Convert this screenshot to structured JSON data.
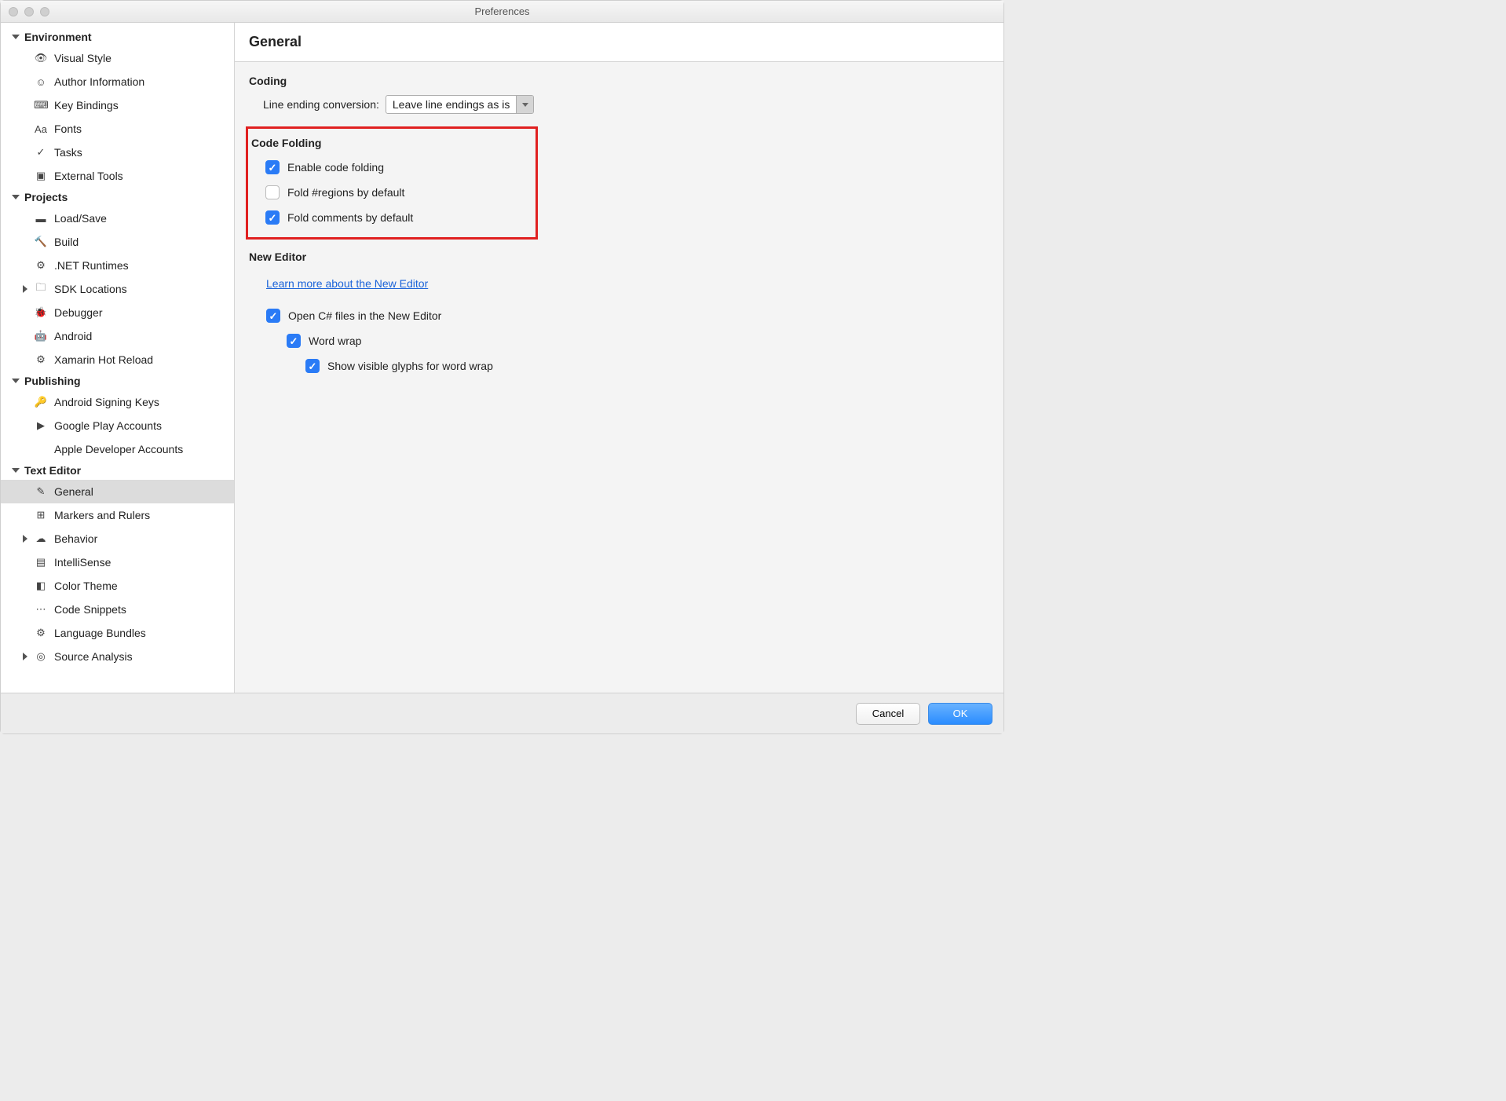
{
  "window_title": "Preferences",
  "sidebar": {
    "categories": [
      {
        "name": "Environment",
        "items": [
          {
            "label": "Visual Style",
            "icon": "👁"
          },
          {
            "label": "Author Information",
            "icon": "☺"
          },
          {
            "label": "Key Bindings",
            "icon": "⌨"
          },
          {
            "label": "Fonts",
            "icon": "Aa"
          },
          {
            "label": "Tasks",
            "icon": "✓"
          },
          {
            "label": "External Tools",
            "icon": "▣"
          }
        ]
      },
      {
        "name": "Projects",
        "items": [
          {
            "label": "Load/Save",
            "icon": "▬"
          },
          {
            "label": "Build",
            "icon": "🔨"
          },
          {
            "label": ".NET Runtimes",
            "icon": "⚙"
          },
          {
            "label": "SDK Locations",
            "icon": "🗀",
            "has_children": true
          },
          {
            "label": "Debugger",
            "icon": "🐞"
          },
          {
            "label": "Android",
            "icon": "🤖"
          },
          {
            "label": "Xamarin Hot Reload",
            "icon": "⚙"
          }
        ]
      },
      {
        "name": "Publishing",
        "items": [
          {
            "label": "Android Signing Keys",
            "icon": "🔑"
          },
          {
            "label": "Google Play Accounts",
            "icon": "▶"
          },
          {
            "label": "Apple Developer Accounts",
            "icon": ""
          }
        ]
      },
      {
        "name": "Text Editor",
        "items": [
          {
            "label": "General",
            "icon": "✎",
            "selected": true
          },
          {
            "label": "Markers and Rulers",
            "icon": "⊞"
          },
          {
            "label": "Behavior",
            "icon": "☁",
            "has_children": true
          },
          {
            "label": "IntelliSense",
            "icon": "▤"
          },
          {
            "label": "Color Theme",
            "icon": "◧"
          },
          {
            "label": "Code Snippets",
            "icon": "⋯"
          },
          {
            "label": "Language Bundles",
            "icon": "⚙"
          },
          {
            "label": "Source Analysis",
            "icon": "◎",
            "has_children": true
          }
        ]
      }
    ]
  },
  "main": {
    "header": "General",
    "coding": {
      "title": "Coding",
      "line_ending_label": "Line ending conversion:",
      "line_ending_value": "Leave line endings as is"
    },
    "code_folding": {
      "title": "Code Folding",
      "opt1": {
        "label": "Enable code folding",
        "checked": true
      },
      "opt2": {
        "label": "Fold #regions by default",
        "checked": false
      },
      "opt3": {
        "label": "Fold comments by default",
        "checked": true
      }
    },
    "new_editor": {
      "title": "New Editor",
      "link": "Learn more about the New Editor",
      "opt1": {
        "label": "Open C# files in the New Editor",
        "checked": true
      },
      "opt2": {
        "label": "Word wrap",
        "checked": true
      },
      "opt3": {
        "label": "Show visible glyphs for word wrap",
        "checked": true
      }
    }
  },
  "footer": {
    "cancel": "Cancel",
    "ok": "OK"
  }
}
